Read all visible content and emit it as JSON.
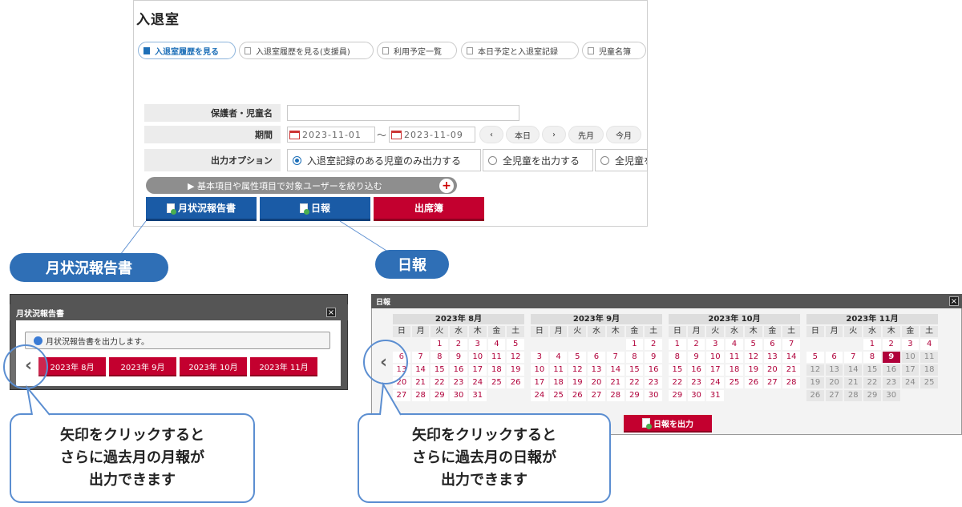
{
  "app": {
    "title": "入退室"
  },
  "tabs": [
    "入退室履歴を見る",
    "入退室履歴を見る(支援員)",
    "利用予定一覧",
    "本日予定と入退室記録",
    "児童名簿"
  ],
  "form": {
    "guardian_label": "保護者・児童名",
    "period_label": "期間",
    "date_from": "2023-11-01",
    "tilde": "〜",
    "date_to": "2023-11-09",
    "nav": [
      "‹",
      "本日",
      "›",
      "先月",
      "今月"
    ],
    "option_label": "出力オプション",
    "options": [
      "入退室記録のある児童のみ出力する",
      "全児童を出力する",
      "全児童を"
    ],
    "filter_text": "▶ 基本項目や属性項目で対象ユーザーを絞り込む",
    "filter_plus": "+"
  },
  "buttons": {
    "monthly": "月状況報告書",
    "daily": "日報",
    "attendance": "出席簿"
  },
  "callouts": {
    "monthly": "月状況報告書",
    "daily": "日報"
  },
  "monthly_dialog": {
    "title": "月状況報告書",
    "close": "×",
    "info": "月状況報告書を出力します。",
    "arrow": "‹",
    "months": [
      "2023年 8月",
      "2023年 9月",
      "2023年 10月",
      "2023年 11月"
    ]
  },
  "daily_dialog": {
    "title": "日報",
    "close": "×",
    "arrow": "‹",
    "weekdays": [
      "日",
      "月",
      "火",
      "水",
      "木",
      "金",
      "土"
    ],
    "months": [
      {
        "title": "2023年 8月",
        "offset": 2,
        "days": 31,
        "disabled_from": 0
      },
      {
        "title": "2023年 9月",
        "offset": 5,
        "days": 30,
        "disabled_from": 0
      },
      {
        "title": "2023年 10月",
        "offset": 0,
        "days": 31,
        "disabled_from": 0
      },
      {
        "title": "2023年 11月",
        "offset": 3,
        "days": 30,
        "disabled_from": 10,
        "selected": 9
      }
    ],
    "output_button": "日報を出力"
  },
  "bubbles": {
    "monthly": [
      "矢印をクリックすると",
      "さらに過去月の月報が",
      "出力できます"
    ],
    "daily": [
      "矢印をクリックすると",
      "さらに過去月の日報が",
      "出力できます"
    ]
  }
}
